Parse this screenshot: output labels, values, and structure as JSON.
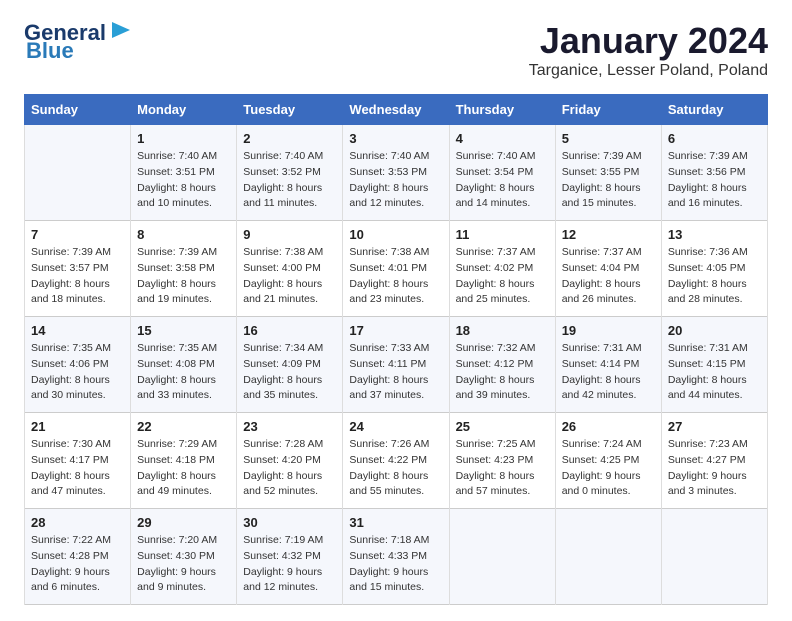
{
  "header": {
    "logo_line1": "General",
    "logo_line2": "Blue",
    "title": "January 2024",
    "location": "Targanice, Lesser Poland, Poland"
  },
  "days_of_week": [
    "Sunday",
    "Monday",
    "Tuesday",
    "Wednesday",
    "Thursday",
    "Friday",
    "Saturday"
  ],
  "weeks": [
    [
      {
        "day": "",
        "sunrise": "",
        "sunset": "",
        "daylight": ""
      },
      {
        "day": "1",
        "sunrise": "Sunrise: 7:40 AM",
        "sunset": "Sunset: 3:51 PM",
        "daylight": "Daylight: 8 hours and 10 minutes."
      },
      {
        "day": "2",
        "sunrise": "Sunrise: 7:40 AM",
        "sunset": "Sunset: 3:52 PM",
        "daylight": "Daylight: 8 hours and 11 minutes."
      },
      {
        "day": "3",
        "sunrise": "Sunrise: 7:40 AM",
        "sunset": "Sunset: 3:53 PM",
        "daylight": "Daylight: 8 hours and 12 minutes."
      },
      {
        "day": "4",
        "sunrise": "Sunrise: 7:40 AM",
        "sunset": "Sunset: 3:54 PM",
        "daylight": "Daylight: 8 hours and 14 minutes."
      },
      {
        "day": "5",
        "sunrise": "Sunrise: 7:39 AM",
        "sunset": "Sunset: 3:55 PM",
        "daylight": "Daylight: 8 hours and 15 minutes."
      },
      {
        "day": "6",
        "sunrise": "Sunrise: 7:39 AM",
        "sunset": "Sunset: 3:56 PM",
        "daylight": "Daylight: 8 hours and 16 minutes."
      }
    ],
    [
      {
        "day": "7",
        "sunrise": "Sunrise: 7:39 AM",
        "sunset": "Sunset: 3:57 PM",
        "daylight": "Daylight: 8 hours and 18 minutes."
      },
      {
        "day": "8",
        "sunrise": "Sunrise: 7:39 AM",
        "sunset": "Sunset: 3:58 PM",
        "daylight": "Daylight: 8 hours and 19 minutes."
      },
      {
        "day": "9",
        "sunrise": "Sunrise: 7:38 AM",
        "sunset": "Sunset: 4:00 PM",
        "daylight": "Daylight: 8 hours and 21 minutes."
      },
      {
        "day": "10",
        "sunrise": "Sunrise: 7:38 AM",
        "sunset": "Sunset: 4:01 PM",
        "daylight": "Daylight: 8 hours and 23 minutes."
      },
      {
        "day": "11",
        "sunrise": "Sunrise: 7:37 AM",
        "sunset": "Sunset: 4:02 PM",
        "daylight": "Daylight: 8 hours and 25 minutes."
      },
      {
        "day": "12",
        "sunrise": "Sunrise: 7:37 AM",
        "sunset": "Sunset: 4:04 PM",
        "daylight": "Daylight: 8 hours and 26 minutes."
      },
      {
        "day": "13",
        "sunrise": "Sunrise: 7:36 AM",
        "sunset": "Sunset: 4:05 PM",
        "daylight": "Daylight: 8 hours and 28 minutes."
      }
    ],
    [
      {
        "day": "14",
        "sunrise": "Sunrise: 7:35 AM",
        "sunset": "Sunset: 4:06 PM",
        "daylight": "Daylight: 8 hours and 30 minutes."
      },
      {
        "day": "15",
        "sunrise": "Sunrise: 7:35 AM",
        "sunset": "Sunset: 4:08 PM",
        "daylight": "Daylight: 8 hours and 33 minutes."
      },
      {
        "day": "16",
        "sunrise": "Sunrise: 7:34 AM",
        "sunset": "Sunset: 4:09 PM",
        "daylight": "Daylight: 8 hours and 35 minutes."
      },
      {
        "day": "17",
        "sunrise": "Sunrise: 7:33 AM",
        "sunset": "Sunset: 4:11 PM",
        "daylight": "Daylight: 8 hours and 37 minutes."
      },
      {
        "day": "18",
        "sunrise": "Sunrise: 7:32 AM",
        "sunset": "Sunset: 4:12 PM",
        "daylight": "Daylight: 8 hours and 39 minutes."
      },
      {
        "day": "19",
        "sunrise": "Sunrise: 7:31 AM",
        "sunset": "Sunset: 4:14 PM",
        "daylight": "Daylight: 8 hours and 42 minutes."
      },
      {
        "day": "20",
        "sunrise": "Sunrise: 7:31 AM",
        "sunset": "Sunset: 4:15 PM",
        "daylight": "Daylight: 8 hours and 44 minutes."
      }
    ],
    [
      {
        "day": "21",
        "sunrise": "Sunrise: 7:30 AM",
        "sunset": "Sunset: 4:17 PM",
        "daylight": "Daylight: 8 hours and 47 minutes."
      },
      {
        "day": "22",
        "sunrise": "Sunrise: 7:29 AM",
        "sunset": "Sunset: 4:18 PM",
        "daylight": "Daylight: 8 hours and 49 minutes."
      },
      {
        "day": "23",
        "sunrise": "Sunrise: 7:28 AM",
        "sunset": "Sunset: 4:20 PM",
        "daylight": "Daylight: 8 hours and 52 minutes."
      },
      {
        "day": "24",
        "sunrise": "Sunrise: 7:26 AM",
        "sunset": "Sunset: 4:22 PM",
        "daylight": "Daylight: 8 hours and 55 minutes."
      },
      {
        "day": "25",
        "sunrise": "Sunrise: 7:25 AM",
        "sunset": "Sunset: 4:23 PM",
        "daylight": "Daylight: 8 hours and 57 minutes."
      },
      {
        "day": "26",
        "sunrise": "Sunrise: 7:24 AM",
        "sunset": "Sunset: 4:25 PM",
        "daylight": "Daylight: 9 hours and 0 minutes."
      },
      {
        "day": "27",
        "sunrise": "Sunrise: 7:23 AM",
        "sunset": "Sunset: 4:27 PM",
        "daylight": "Daylight: 9 hours and 3 minutes."
      }
    ],
    [
      {
        "day": "28",
        "sunrise": "Sunrise: 7:22 AM",
        "sunset": "Sunset: 4:28 PM",
        "daylight": "Daylight: 9 hours and 6 minutes."
      },
      {
        "day": "29",
        "sunrise": "Sunrise: 7:20 AM",
        "sunset": "Sunset: 4:30 PM",
        "daylight": "Daylight: 9 hours and 9 minutes."
      },
      {
        "day": "30",
        "sunrise": "Sunrise: 7:19 AM",
        "sunset": "Sunset: 4:32 PM",
        "daylight": "Daylight: 9 hours and 12 minutes."
      },
      {
        "day": "31",
        "sunrise": "Sunrise: 7:18 AM",
        "sunset": "Sunset: 4:33 PM",
        "daylight": "Daylight: 9 hours and 15 minutes."
      },
      {
        "day": "",
        "sunrise": "",
        "sunset": "",
        "daylight": ""
      },
      {
        "day": "",
        "sunrise": "",
        "sunset": "",
        "daylight": ""
      },
      {
        "day": "",
        "sunrise": "",
        "sunset": "",
        "daylight": ""
      }
    ]
  ]
}
